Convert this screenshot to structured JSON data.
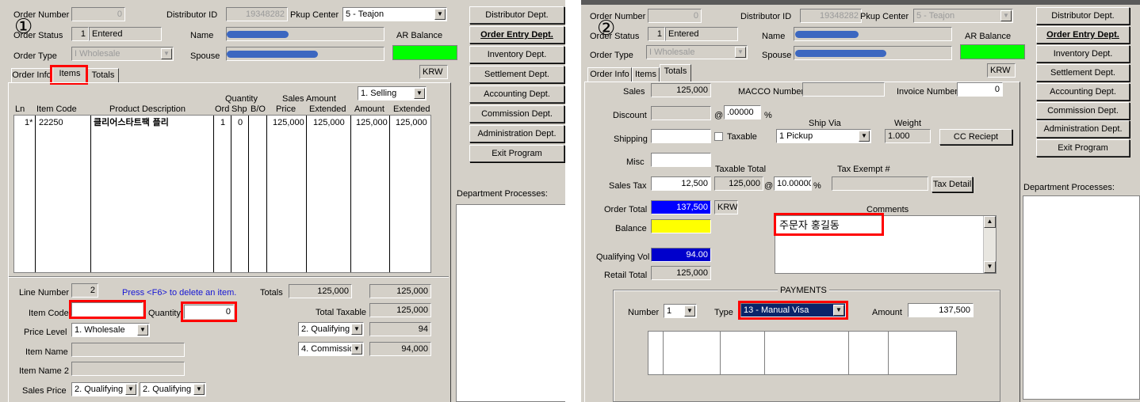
{
  "left": {
    "step_marker": "①",
    "header": {
      "order_number_label": "Order Number",
      "order_number_value": "0",
      "distributor_id_label": "Distributor ID",
      "distributor_id_value": "19348282",
      "pkup_center_label": "Pkup Center",
      "pkup_center_value": "5 - Teajon",
      "order_status_label": "Order Status",
      "order_status_num": "1",
      "order_status_value": "Entered",
      "name_label": "Name",
      "ar_balance_label": "AR Balance",
      "order_type_label": "Order Type",
      "order_type_value": "I Wholesale",
      "spouse_label": "Spouse"
    },
    "tabs": [
      "Order Info",
      "Items",
      "Totals"
    ],
    "currency": "KRW",
    "price_type": "1. Selling",
    "columns": {
      "ln": "Ln",
      "item_code": "Item Code",
      "product_description": "Product Description",
      "quantity": "Quantity",
      "ord": "Ord",
      "shp": "Shp",
      "bo": "B/O",
      "sales_amount": "Sales Amount",
      "price": "Price",
      "extended": "Extended",
      "amount": "Amount",
      "extended2": "Extended"
    },
    "rows": [
      {
        "ln": "1*",
        "item_code": "22250",
        "description": "클리어스타트팩 플리",
        "ord": "1",
        "shp": "0",
        "bo": "",
        "price": "125,000",
        "extended": "125,000",
        "amount": "125,000",
        "extended2": "125,000"
      }
    ],
    "lower": {
      "line_number_label": "Line Number",
      "line_number_value": "2",
      "delete_hint": "Press <F6> to delete an item.",
      "item_code_label": "Item Code",
      "item_code_value": "",
      "quantity_label": "Quantity",
      "quantity_value": "0",
      "price_level_label": "Price Level",
      "price_level_value": "1. Wholesale",
      "item_name_label": "Item Name",
      "item_name2_label": "Item Name 2",
      "sales_price_label": "Sales Price",
      "sales_price_value1": "2. Qualifying",
      "sales_price_value2": "2. Qualifying",
      "totals_label": "Totals",
      "totals_value1": "125,000",
      "totals_value2": "125,000",
      "total_taxable_label": "Total Taxable",
      "total_taxable_value": "125,000",
      "qualifying_select": "2. Qualifying",
      "qualifying_value": "94",
      "commission_select": "4. Commission",
      "commission_value": "94,000"
    },
    "buttons": [
      "Distributor Dept.",
      "Order Entry Dept.",
      "Inventory Dept.",
      "Settlement Dept.",
      "Accounting Dept.",
      "Commission Dept.",
      "Administration Dept.",
      "Exit Program"
    ],
    "department_processes_label": "Department Processes:"
  },
  "right": {
    "step_marker": "②",
    "header": {
      "order_number_label": "Order Number",
      "order_number_value": "0",
      "distributor_id_label": "Distributor ID",
      "distributor_id_value": "19348282",
      "pkup_center_label": "Pkup Center",
      "pkup_center_value": "5 - Teajon",
      "order_status_label": "Order Status",
      "order_status_num": "1",
      "order_status_value": "Entered",
      "name_label": "Name",
      "ar_balance_label": "AR Balance",
      "order_type_label": "Order Type",
      "order_type_value": "I Wholesale",
      "spouse_label": "Spouse"
    },
    "tabs": [
      "Order Info",
      "Items",
      "Totals"
    ],
    "currency": "KRW",
    "totals": {
      "sales_label": "Sales",
      "sales_value": "125,000",
      "macco_label": "MACCO Number",
      "invoice_label": "Invoice Number",
      "invoice_value": "0",
      "discount_label": "Discount",
      "discount_pct": ".00000",
      "pct_sign": "%",
      "ship_via_label": "Ship Via",
      "weight_label": "Weight",
      "shipping_label": "Shipping",
      "taxable_label": "Taxable",
      "ship_via_value": "1 Pickup",
      "weight_value": "1.000",
      "cc_receipt_button": "CC Reciept",
      "misc_label": "Misc",
      "taxable_total_label": "Taxable Total",
      "tax_exempt_label": "Tax Exempt #",
      "sales_tax_label": "Sales Tax",
      "sales_tax_value": "12,500",
      "taxable_total_value": "125,000",
      "tax_rate": "10.00000",
      "tax_detail_button": "Tax Detail",
      "order_total_label": "Order Total",
      "order_total_value": "137,500",
      "order_total_currency": "KRW",
      "comments_label": "Comments",
      "comments_value": "주문자 홍길동",
      "balance_label": "Balance",
      "qualifying_vol_label": "Qualifying Vol",
      "qualifying_vol_value": "94.00",
      "retail_total_label": "Retail Total",
      "retail_total_value": "125,000"
    },
    "payments": {
      "title": "PAYMENTS",
      "number_label": "Number",
      "number_value": "1",
      "type_label": "Type",
      "type_value": "13 - Manual Visa",
      "amount_label": "Amount",
      "amount_value": "137,500"
    },
    "buttons": [
      "Distributor Dept.",
      "Order Entry Dept.",
      "Inventory Dept.",
      "Settlement Dept.",
      "Accounting Dept.",
      "Commission Dept.",
      "Administration Dept.",
      "Exit Program"
    ],
    "department_processes_label": "Department Processes:"
  },
  "colors": {
    "ar_balance": "#00ff00",
    "order_total": "#0000ff",
    "balance": "#ffff00",
    "qualifying_vol": "#0000cc",
    "highlight": "#ff0000"
  }
}
